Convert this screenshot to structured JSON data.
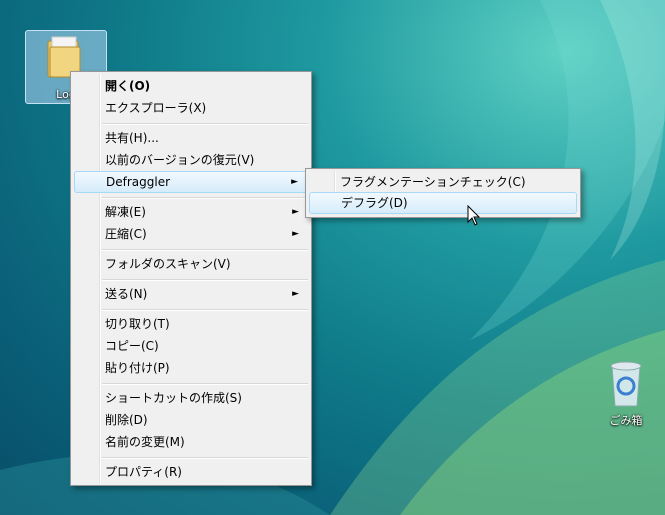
{
  "desktop": {
    "folder_label": "Log",
    "recycle_bin_label": "ごみ箱"
  },
  "context_menu": {
    "items": [
      {
        "label": "開く(O)",
        "bold": true
      },
      {
        "label": "エクスプローラ(X)"
      },
      {
        "label": "共有(H)..."
      },
      {
        "label": "以前のバージョンの復元(V)"
      },
      {
        "label": "Defraggler",
        "submenu": true,
        "highlighted": true
      },
      {
        "label": "解凍(E)",
        "submenu": true
      },
      {
        "label": "圧縮(C)",
        "submenu": true
      },
      {
        "label": "フォルダのスキャン(V)"
      },
      {
        "label": "送る(N)",
        "submenu": true
      },
      {
        "label": "切り取り(T)"
      },
      {
        "label": "コピー(C)"
      },
      {
        "label": "貼り付け(P)"
      },
      {
        "label": "ショートカットの作成(S)"
      },
      {
        "label": "削除(D)"
      },
      {
        "label": "名前の変更(M)"
      },
      {
        "label": "プロパティ(R)"
      }
    ],
    "submenu_arrow": "►"
  },
  "defraggler_submenu": {
    "items": [
      {
        "label": "フラグメンテーションチェック(C)"
      },
      {
        "label": "デフラグ(D)",
        "highlighted": true
      }
    ]
  },
  "colors": {
    "menu_bg": "#f0f0f0",
    "highlight": "#d6ecfb",
    "highlight_border": "#a8d8f8"
  }
}
